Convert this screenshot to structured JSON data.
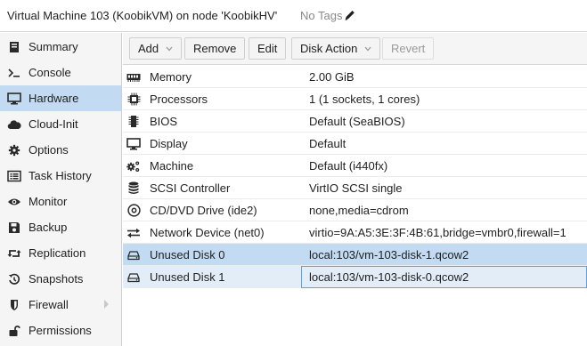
{
  "header": {
    "title": "Virtual Machine 103 (KoobikVM) on node 'KoobikHV'",
    "tags_label": "No Tags",
    "tags_icon": "pencil-icon"
  },
  "sidebar": {
    "items": [
      {
        "label": "Summary",
        "icon": "book-icon",
        "active": false
      },
      {
        "label": "Console",
        "icon": "terminal-icon",
        "active": false
      },
      {
        "label": "Hardware",
        "icon": "desktop-icon",
        "active": true
      },
      {
        "label": "Cloud-Init",
        "icon": "cloud-icon",
        "active": false
      },
      {
        "label": "Options",
        "icon": "gear-icon",
        "active": false
      },
      {
        "label": "Task History",
        "icon": "list-alt-icon",
        "active": false
      },
      {
        "label": "Monitor",
        "icon": "eye-icon",
        "active": false
      },
      {
        "label": "Backup",
        "icon": "floppy-icon",
        "active": false
      },
      {
        "label": "Replication",
        "icon": "retweet-icon",
        "active": false
      },
      {
        "label": "Snapshots",
        "icon": "history-icon",
        "active": false
      },
      {
        "label": "Firewall",
        "icon": "shield-icon",
        "active": false,
        "expandable": true
      },
      {
        "label": "Permissions",
        "icon": "unlock-icon",
        "active": false
      }
    ]
  },
  "toolbar": {
    "add_label": "Add",
    "remove_label": "Remove",
    "edit_label": "Edit",
    "disk_action_label": "Disk Action",
    "revert_label": "Revert"
  },
  "hardware": {
    "rows": [
      {
        "name": "Memory",
        "value": "2.00 GiB",
        "icon": "memory-icon"
      },
      {
        "name": "Processors",
        "value": "1 (1 sockets, 1 cores)",
        "icon": "cpu-icon"
      },
      {
        "name": "BIOS",
        "value": "Default (SeaBIOS)",
        "icon": "microchip-icon"
      },
      {
        "name": "Display",
        "value": "Default",
        "icon": "monitor-icon"
      },
      {
        "name": "Machine",
        "value": "Default (i440fx)",
        "icon": "cogs-icon"
      },
      {
        "name": "SCSI Controller",
        "value": "VirtIO SCSI single",
        "icon": "database-icon"
      },
      {
        "name": "CD/DVD Drive (ide2)",
        "value": "none,media=cdrom",
        "icon": "cdrom-icon"
      },
      {
        "name": "Network Device (net0)",
        "value": "virtio=9A:A5:3E:3F:4B:61,bridge=vmbr0,firewall=1",
        "icon": "exchange-icon"
      },
      {
        "name": "Unused Disk 0",
        "value": "local:103/vm-103-disk-1.qcow2",
        "icon": "hdd-icon",
        "state": "selected"
      },
      {
        "name": "Unused Disk 1",
        "value": "local:103/vm-103-disk-0.qcow2",
        "icon": "hdd-icon",
        "state": "hover"
      }
    ]
  },
  "colors": {
    "selection": "#c2dbf2",
    "hover": "#e2edf8",
    "focus_border": "#5fa2dd"
  }
}
